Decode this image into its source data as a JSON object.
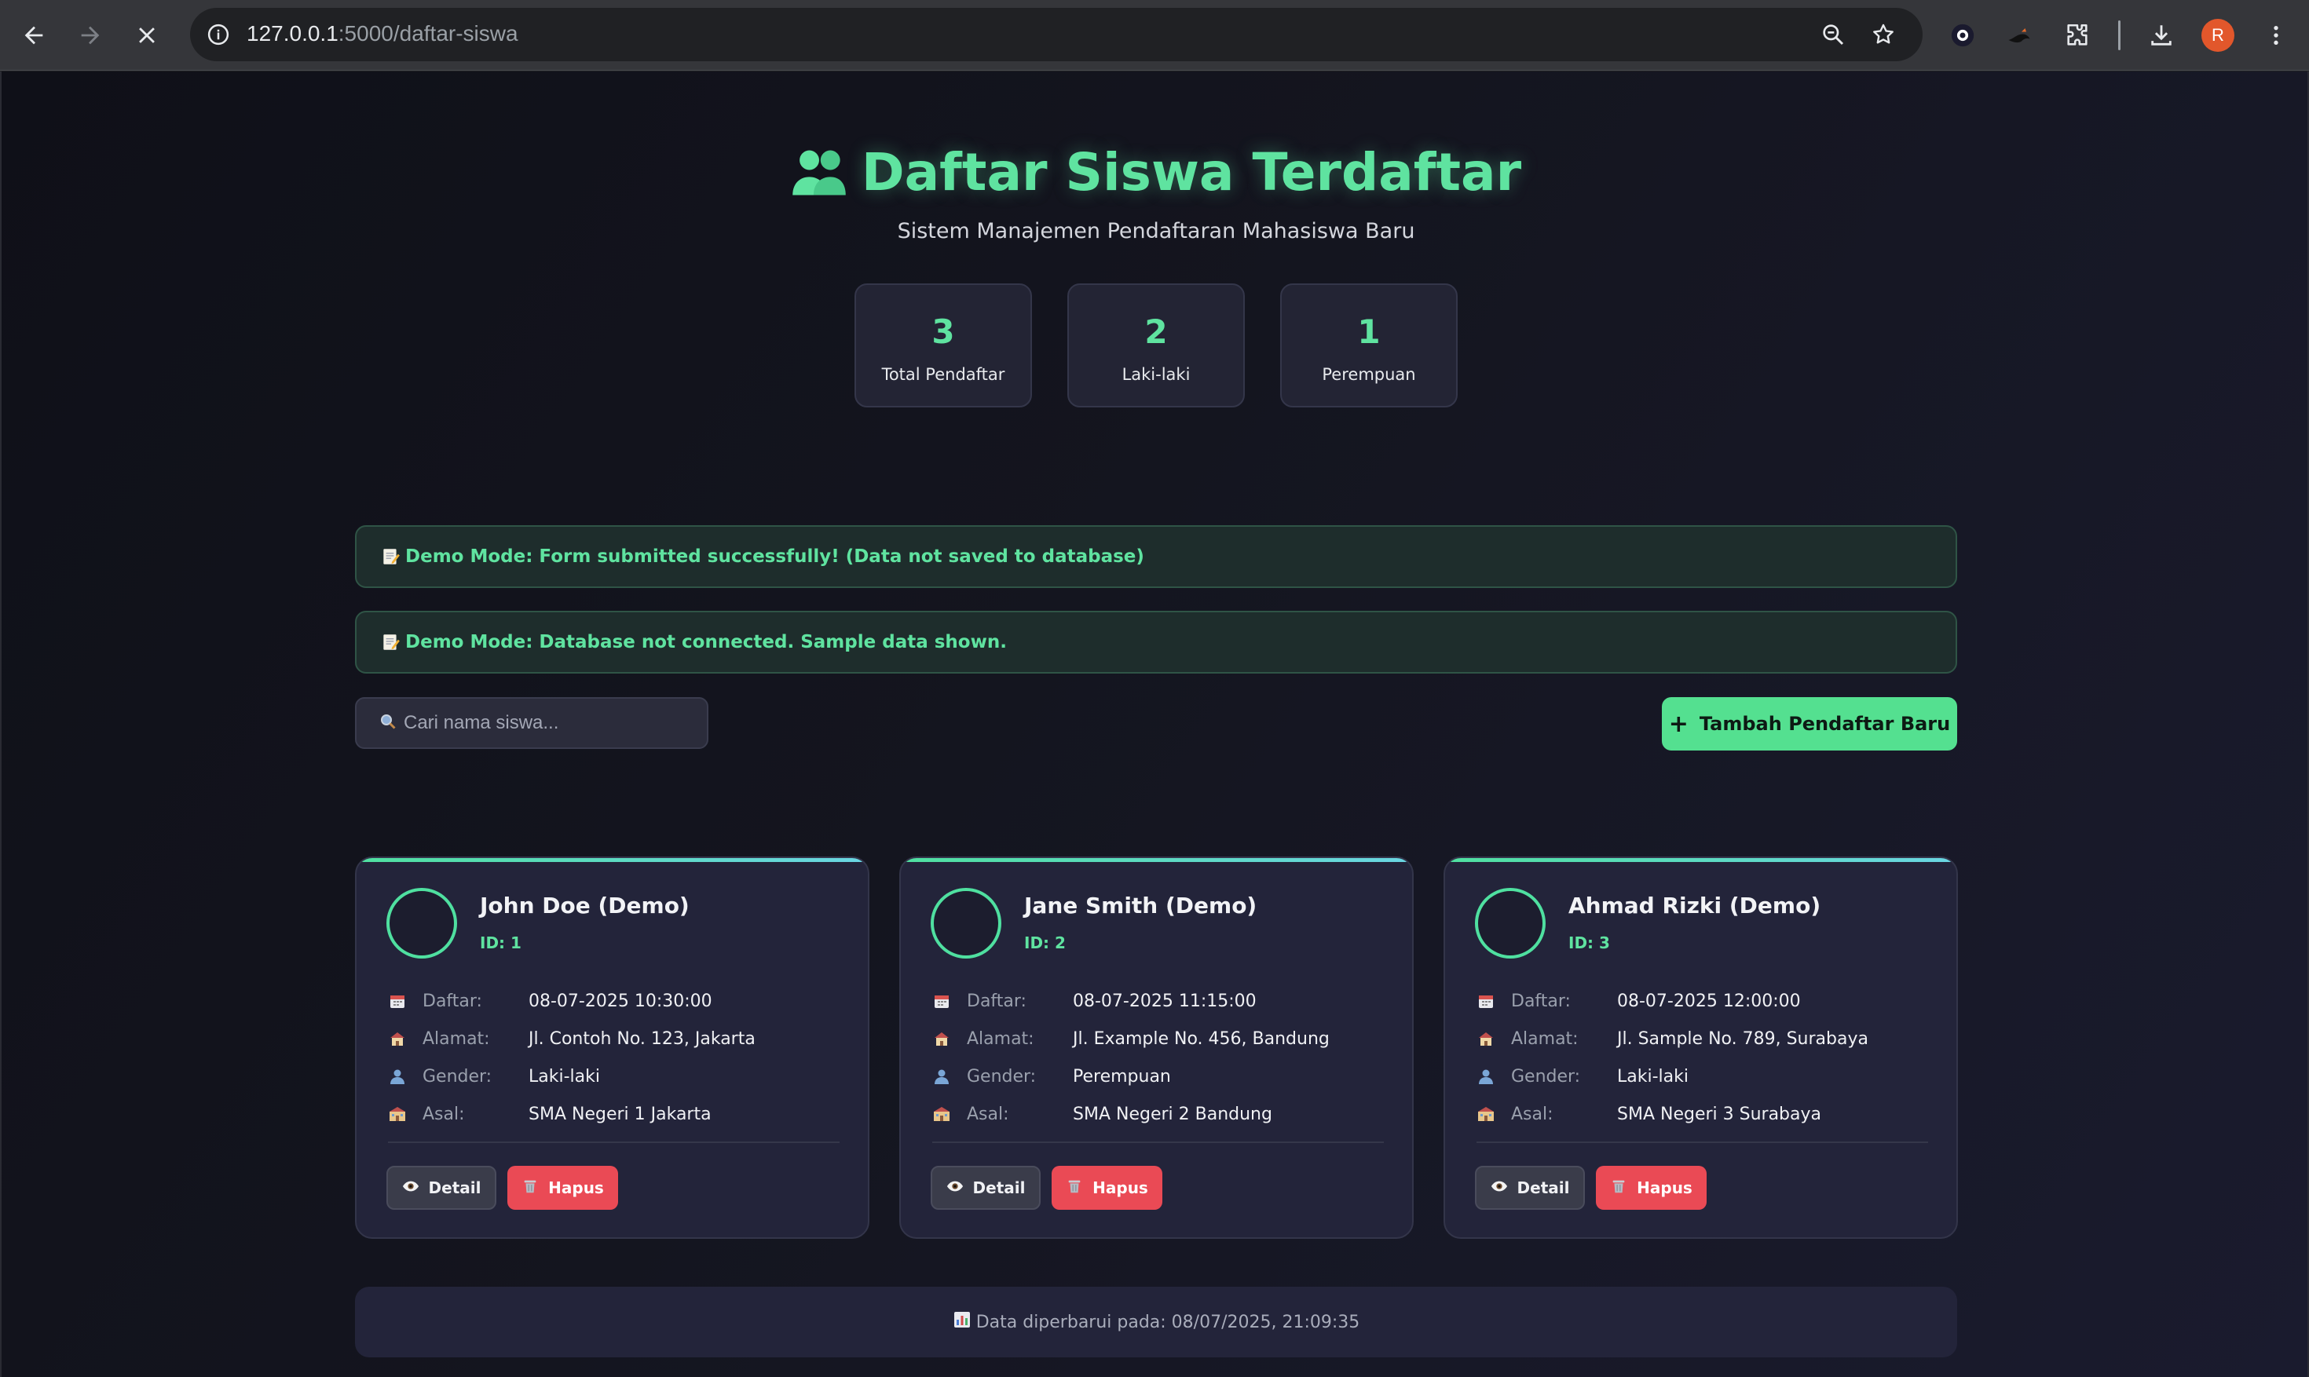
{
  "browser": {
    "url_host": "127.0.0.1",
    "url_path": ":5000/daftar-siswa",
    "profile_initial": "R"
  },
  "header": {
    "title": "Daftar Siswa Terdaftar",
    "subtitle": "Sistem Manajemen Pendaftaran Mahasiswa Baru"
  },
  "stats": [
    {
      "value": "3",
      "label": "Total Pendaftar"
    },
    {
      "value": "2",
      "label": "Laki-laki"
    },
    {
      "value": "1",
      "label": "Perempuan"
    }
  ],
  "alerts": [
    "Demo Mode: Form submitted successfully! (Data not saved to database)",
    "Demo Mode: Database not connected. Sample data shown."
  ],
  "search": {
    "placeholder": "Cari nama siswa..."
  },
  "add_button": {
    "label": "Tambah Pendaftar Baru"
  },
  "field_labels": {
    "daftar": "Daftar:",
    "alamat": "Alamat:",
    "gender": "Gender:",
    "asal": "Asal:"
  },
  "card_buttons": {
    "detail": "Detail",
    "hapus": "Hapus"
  },
  "students": [
    {
      "name": "John Doe (Demo)",
      "id": "ID: 1",
      "daftar": "08-07-2025 10:30:00",
      "alamat": "Jl. Contoh No. 123, Jakarta",
      "gender": "Laki-laki",
      "asal": "SMA Negeri 1 Jakarta"
    },
    {
      "name": "Jane Smith (Demo)",
      "id": "ID: 2",
      "daftar": "08-07-2025 11:15:00",
      "alamat": "Jl. Example No. 456, Bandung",
      "gender": "Perempuan",
      "asal": "SMA Negeri 2 Bandung"
    },
    {
      "name": "Ahmad Rizki (Demo)",
      "id": "ID: 3",
      "daftar": "08-07-2025 12:00:00",
      "alamat": "Jl. Sample No. 789, Surabaya",
      "gender": "Laki-laki",
      "asal": "SMA Negeri 3 Surabaya"
    }
  ],
  "footer": {
    "text": "Data diperbarui pada: 08/07/2025, 21:09:35"
  },
  "colors": {
    "accent": "#5fe3a0",
    "danger": "#ea4a55",
    "brand_button": "#54e090"
  }
}
